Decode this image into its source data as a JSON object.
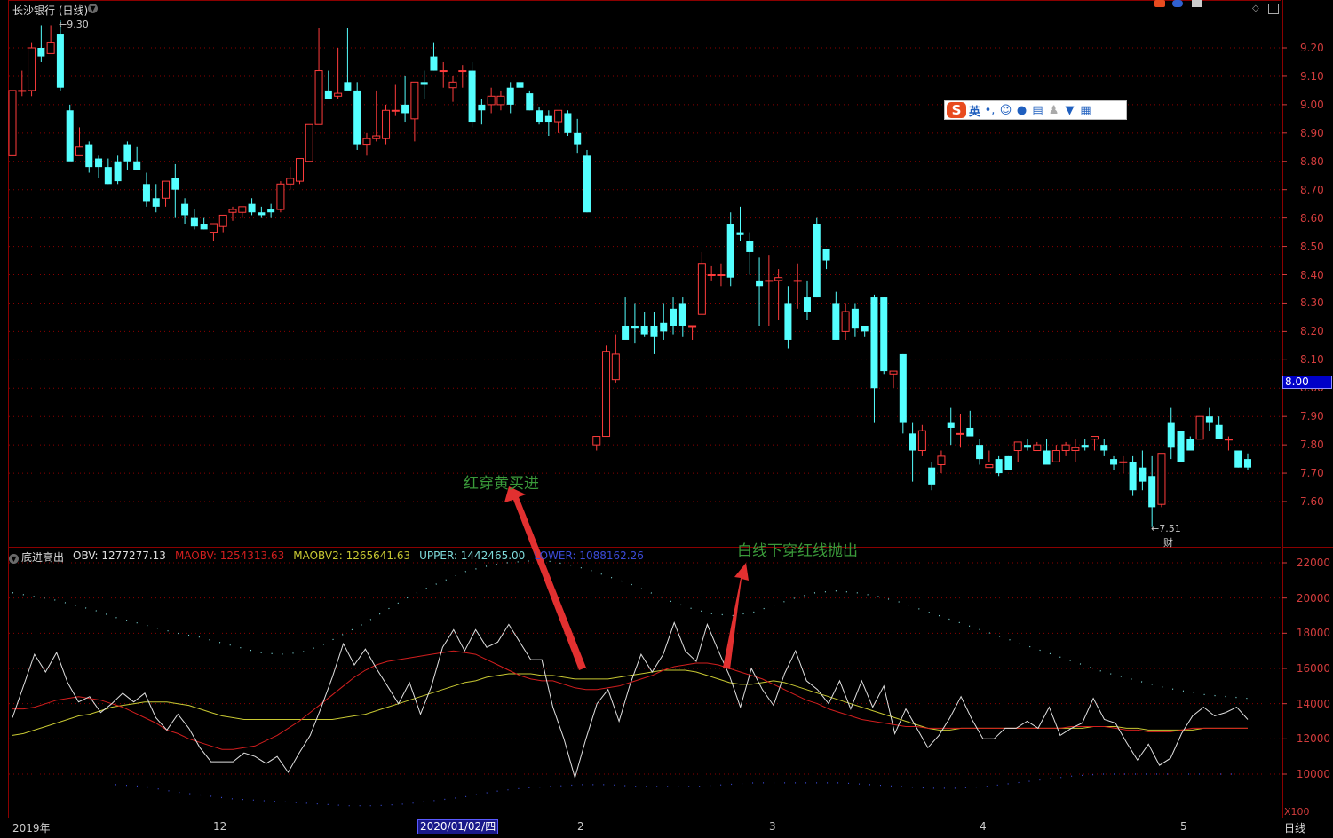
{
  "window": {
    "title": "长沙银行 (日线)",
    "max_label": "9.30",
    "min_label": "7.51",
    "event_marker": "财",
    "period": "日线",
    "x100": "X100"
  },
  "price_badge": "8.00",
  "main_axis_ticks": [
    "9.20",
    "9.10",
    "9.00",
    "8.90",
    "8.80",
    "8.70",
    "8.60",
    "8.50",
    "8.40",
    "8.30",
    "8.20",
    "8.10",
    "8.00",
    "7.90",
    "7.80",
    "7.70",
    "7.60"
  ],
  "indicator_axis_ticks": [
    "22000",
    "20000",
    "18000",
    "16000",
    "14000",
    "12000",
    "10000"
  ],
  "indicator": {
    "name": "底进高出",
    "obv_label": "OBV: 1277277.13",
    "maobv_label": "MAOBV: 1254313.63",
    "maobv2_label": "MAOBV2: 1265641.63",
    "upper_label": "UPPER: 1442465.00",
    "lower_label": "LOWER: 1088162.26",
    "colors": {
      "obv": "#e0e0e0",
      "maobv": "#d21e1e",
      "maobv2": "#c8c832",
      "upper": "#7fdcdc",
      "lower": "#3b4bd8"
    }
  },
  "annotations": {
    "buy": "红穿黄买进",
    "sell": "白线下穿红线抛出"
  },
  "ime": {
    "lang": "英",
    "punct": "•,"
  },
  "date_axis": {
    "year": "2019年",
    "m12": "12",
    "selected_date": "2020/01/02/四",
    "m2": "2",
    "m3": "3",
    "m4": "4",
    "m5": "5"
  },
  "colors": {
    "up": "#ff3c3c",
    "down": "#54ffff",
    "grid": "#8b0000",
    "axis_text": "#d23c3c"
  },
  "chart_data": {
    "type": "candlestick",
    "y_range": [
      7.5,
      9.3
    ],
    "ohlc": [
      [
        8.82,
        9.05,
        8.82,
        9.05
      ],
      [
        9.05,
        9.12,
        9.03,
        9.05
      ],
      [
        9.05,
        9.22,
        9.03,
        9.2
      ],
      [
        9.2,
        9.28,
        9.15,
        9.17
      ],
      [
        9.18,
        9.28,
        9.18,
        9.22
      ],
      [
        9.25,
        9.3,
        9.05,
        9.06
      ],
      [
        8.98,
        9.0,
        8.86,
        8.8
      ],
      [
        8.82,
        8.92,
        8.82,
        8.85
      ],
      [
        8.86,
        8.87,
        8.76,
        8.78
      ],
      [
        8.81,
        8.82,
        8.74,
        8.78
      ],
      [
        8.78,
        8.81,
        8.72,
        8.72
      ],
      [
        8.8,
        8.82,
        8.72,
        8.73
      ],
      [
        8.86,
        8.87,
        8.77,
        8.8
      ],
      [
        8.8,
        8.85,
        8.77,
        8.77
      ],
      [
        8.72,
        8.76,
        8.64,
        8.66
      ],
      [
        8.67,
        8.72,
        8.62,
        8.64
      ],
      [
        8.67,
        8.73,
        8.64,
        8.73
      ],
      [
        8.74,
        8.79,
        8.6,
        8.7
      ],
      [
        8.65,
        8.67,
        8.58,
        8.61
      ],
      [
        8.6,
        8.63,
        8.56,
        8.57
      ],
      [
        8.58,
        8.6,
        8.56,
        8.56
      ],
      [
        8.55,
        8.58,
        8.52,
        8.58
      ],
      [
        8.57,
        8.61,
        8.55,
        8.61
      ],
      [
        8.62,
        8.64,
        8.59,
        8.63
      ],
      [
        8.62,
        8.64,
        8.6,
        8.64
      ],
      [
        8.65,
        8.67,
        8.61,
        8.62
      ],
      [
        8.62,
        8.64,
        8.6,
        8.61
      ],
      [
        8.63,
        8.65,
        8.6,
        8.62
      ],
      [
        8.63,
        8.73,
        8.62,
        8.72
      ],
      [
        8.72,
        8.78,
        8.7,
        8.74
      ],
      [
        8.73,
        8.81,
        8.72,
        8.81
      ],
      [
        8.8,
        8.93,
        8.8,
        8.93
      ],
      [
        8.93,
        9.27,
        8.93,
        9.12
      ],
      [
        9.05,
        9.12,
        9.02,
        9.02
      ],
      [
        9.03,
        9.2,
        9.02,
        9.04
      ],
      [
        9.08,
        9.27,
        9.07,
        9.05
      ],
      [
        9.05,
        9.08,
        8.84,
        8.86
      ],
      [
        8.86,
        8.9,
        8.82,
        8.88
      ],
      [
        8.88,
        9.05,
        8.87,
        8.89
      ],
      [
        8.88,
        9.0,
        8.86,
        8.98
      ],
      [
        8.98,
        9.07,
        8.96,
        8.98
      ],
      [
        9.0,
        9.1,
        8.94,
        8.97
      ],
      [
        8.95,
        9.05,
        8.87,
        9.08
      ],
      [
        9.08,
        9.12,
        9.02,
        9.07
      ],
      [
        9.17,
        9.22,
        9.12,
        9.12
      ],
      [
        9.12,
        9.15,
        9.06,
        9.12
      ],
      [
        9.06,
        9.1,
        9.01,
        9.08
      ],
      [
        9.12,
        9.14,
        9.06,
        9.12
      ],
      [
        9.12,
        9.15,
        8.92,
        8.94
      ],
      [
        9.0,
        9.02,
        8.93,
        8.98
      ],
      [
        9.0,
        9.06,
        8.97,
        9.03
      ],
      [
        9.0,
        9.05,
        8.98,
        9.03
      ],
      [
        9.06,
        9.08,
        8.97,
        9.0
      ],
      [
        9.08,
        9.11,
        9.05,
        9.06
      ],
      [
        9.04,
        9.05,
        8.98,
        8.98
      ],
      [
        8.98,
        8.99,
        8.93,
        8.94
      ],
      [
        8.96,
        8.98,
        8.89,
        8.94
      ],
      [
        8.94,
        8.98,
        8.9,
        8.98
      ],
      [
        8.97,
        8.98,
        8.89,
        8.9
      ],
      [
        8.9,
        8.95,
        8.83,
        8.86
      ],
      [
        8.82,
        8.84,
        8.62,
        8.62
      ],
      [
        7.8,
        7.82,
        7.78,
        7.83
      ],
      [
        7.83,
        8.15,
        7.83,
        8.13
      ],
      [
        8.03,
        8.19,
        8.02,
        8.12
      ],
      [
        8.22,
        8.32,
        8.18,
        8.17
      ],
      [
        8.22,
        8.3,
        8.16,
        8.21
      ],
      [
        8.22,
        8.27,
        8.18,
        8.19
      ],
      [
        8.22,
        8.27,
        8.12,
        8.18
      ],
      [
        8.23,
        8.3,
        8.17,
        8.2
      ],
      [
        8.28,
        8.32,
        8.19,
        8.22
      ],
      [
        8.3,
        8.32,
        8.18,
        8.22
      ],
      [
        8.22,
        8.22,
        8.17,
        8.22
      ],
      [
        8.26,
        8.48,
        8.26,
        8.44
      ],
      [
        8.4,
        8.43,
        8.38,
        8.4
      ],
      [
        8.4,
        8.44,
        8.36,
        8.4
      ],
      [
        8.58,
        8.62,
        8.36,
        8.39
      ],
      [
        8.55,
        8.64,
        8.52,
        8.54
      ],
      [
        8.52,
        8.55,
        8.4,
        8.48
      ],
      [
        8.38,
        8.46,
        8.22,
        8.36
      ],
      [
        8.38,
        8.47,
        8.22,
        8.38
      ],
      [
        8.38,
        8.42,
        8.24,
        8.39
      ],
      [
        8.3,
        8.36,
        8.14,
        8.17
      ],
      [
        8.38,
        8.44,
        8.28,
        8.38
      ],
      [
        8.32,
        8.38,
        8.24,
        8.27
      ],
      [
        8.58,
        8.6,
        8.32,
        8.32
      ],
      [
        8.49,
        8.48,
        8.42,
        8.45
      ],
      [
        8.3,
        8.34,
        8.17,
        8.17
      ],
      [
        8.2,
        8.3,
        8.17,
        8.27
      ],
      [
        8.28,
        8.3,
        8.18,
        8.21
      ],
      [
        8.22,
        8.22,
        8.18,
        8.2
      ],
      [
        8.32,
        8.33,
        7.88,
        8.0
      ],
      [
        8.32,
        8.32,
        8.05,
        8.06
      ],
      [
        8.05,
        8.05,
        8.0,
        8.06
      ],
      [
        8.12,
        8.12,
        7.84,
        7.88
      ],
      [
        7.84,
        7.88,
        7.67,
        7.78
      ],
      [
        7.78,
        7.87,
        7.76,
        7.85
      ],
      [
        7.72,
        7.74,
        7.64,
        7.66
      ],
      [
        7.73,
        7.78,
        7.7,
        7.76
      ],
      [
        7.88,
        7.93,
        7.8,
        7.86
      ],
      [
        7.84,
        7.91,
        7.79,
        7.84
      ],
      [
        7.86,
        7.92,
        7.84,
        7.83
      ],
      [
        7.8,
        7.82,
        7.73,
        7.75
      ],
      [
        7.72,
        7.78,
        7.74,
        7.73
      ],
      [
        7.75,
        7.76,
        7.69,
        7.7
      ],
      [
        7.76,
        7.76,
        7.71,
        7.71
      ],
      [
        7.78,
        7.8,
        7.74,
        7.81
      ],
      [
        7.8,
        7.82,
        7.78,
        7.79
      ],
      [
        7.78,
        7.81,
        7.78,
        7.8
      ],
      [
        7.78,
        7.82,
        7.75,
        7.73
      ],
      [
        7.74,
        7.8,
        7.74,
        7.78
      ],
      [
        7.78,
        7.81,
        7.76,
        7.8
      ],
      [
        7.78,
        7.82,
        7.74,
        7.79
      ],
      [
        7.8,
        7.82,
        7.78,
        7.79
      ],
      [
        7.82,
        7.82,
        7.78,
        7.83
      ],
      [
        7.8,
        7.82,
        7.76,
        7.78
      ],
      [
        7.75,
        7.76,
        7.71,
        7.73
      ],
      [
        7.74,
        7.76,
        7.7,
        7.74
      ],
      [
        7.74,
        7.76,
        7.62,
        7.64
      ],
      [
        7.72,
        7.78,
        7.64,
        7.67
      ],
      [
        7.69,
        7.76,
        7.51,
        7.58
      ],
      [
        7.59,
        7.77,
        7.58,
        7.77
      ],
      [
        7.88,
        7.93,
        7.75,
        7.79
      ],
      [
        7.85,
        7.85,
        7.76,
        7.74
      ],
      [
        7.82,
        7.83,
        7.78,
        7.78
      ],
      [
        7.82,
        7.9,
        7.82,
        7.9
      ],
      [
        7.9,
        7.93,
        7.85,
        7.88
      ],
      [
        7.87,
        7.9,
        7.83,
        7.82
      ],
      [
        7.82,
        7.83,
        7.78,
        7.82
      ],
      [
        7.78,
        7.78,
        7.72,
        7.72
      ],
      [
        7.75,
        7.77,
        7.71,
        7.72
      ]
    ],
    "obv": [
      13.2,
      15.0,
      16.8,
      15.8,
      16.9,
      15.2,
      14.1,
      14.4,
      13.5,
      14.0,
      14.6,
      14.1,
      14.6,
      13.2,
      12.5,
      13.4,
      12.6,
      11.5,
      10.7,
      10.7,
      10.7,
      11.2,
      11.0,
      10.6,
      11.0,
      10.1,
      11.2,
      12.2,
      13.8,
      15.5,
      17.4,
      16.2,
      17.1,
      16.0,
      15.0,
      14.0,
      15.2,
      13.4,
      15.0,
      17.2,
      18.2,
      17.0,
      18.2,
      17.2,
      17.5,
      18.5,
      17.5,
      16.5,
      16.5,
      13.8,
      12.0,
      9.8,
      12.0,
      14.0,
      14.8,
      13.0,
      15.1,
      16.8,
      15.8,
      16.8,
      18.6,
      17.0,
      16.4,
      18.5,
      17.0,
      15.6,
      13.8,
      16.0,
      14.8,
      13.9,
      15.7,
      17.0,
      15.3,
      14.8,
      14.0,
      15.3,
      13.7,
      15.3,
      13.8,
      15.0,
      12.3,
      13.7,
      12.6,
      11.5,
      12.2,
      13.2,
      14.4,
      13.1,
      12.0,
      12.0,
      12.6,
      12.6,
      13.0,
      12.6,
      13.8,
      12.2,
      12.6,
      12.9,
      14.3,
      13.1,
      12.9,
      11.8,
      10.8,
      11.7,
      10.5,
      10.9,
      12.3,
      13.3,
      13.8,
      13.3,
      13.5,
      13.8,
      13.1
    ],
    "maobv": [
      13.7,
      13.7,
      13.8,
      14.0,
      14.2,
      14.3,
      14.4,
      14.3,
      14.2,
      14.0,
      13.8,
      13.5,
      13.2,
      12.9,
      12.5,
      12.3,
      12.0,
      11.8,
      11.6,
      11.4,
      11.4,
      11.5,
      11.6,
      11.9,
      12.2,
      12.6,
      13.0,
      13.5,
      14.0,
      14.5,
      15.0,
      15.5,
      15.9,
      16.2,
      16.4,
      16.5,
      16.6,
      16.7,
      16.8,
      16.9,
      17.0,
      16.9,
      16.8,
      16.5,
      16.2,
      15.9,
      15.6,
      15.4,
      15.3,
      15.3,
      15.1,
      14.9,
      14.8,
      14.8,
      14.9,
      15.0,
      15.2,
      15.4,
      15.6,
      15.9,
      16.1,
      16.2,
      16.3,
      16.3,
      16.2,
      16.0,
      15.8,
      15.6,
      15.4,
      15.1,
      14.8,
      14.5,
      14.2,
      14.0,
      13.7,
      13.5,
      13.3,
      13.1,
      13.0,
      12.9,
      12.8,
      12.7,
      12.7,
      12.6,
      12.6,
      12.6,
      12.6,
      12.6,
      12.6,
      12.6,
      12.6,
      12.6,
      12.6,
      12.6,
      12.6,
      12.6,
      12.7,
      12.7,
      12.7,
      12.7,
      12.6,
      12.5,
      12.5,
      12.4,
      12.4,
      12.4,
      12.5,
      12.6,
      12.6,
      12.6,
      12.6,
      12.6,
      12.6
    ],
    "maobv2": [
      12.2,
      12.3,
      12.5,
      12.7,
      12.9,
      13.1,
      13.3,
      13.4,
      13.6,
      13.8,
      13.9,
      14.0,
      14.1,
      14.1,
      14.1,
      14.0,
      13.9,
      13.7,
      13.5,
      13.3,
      13.2,
      13.1,
      13.1,
      13.1,
      13.1,
      13.1,
      13.1,
      13.1,
      13.1,
      13.1,
      13.2,
      13.3,
      13.4,
      13.6,
      13.8,
      14.0,
      14.2,
      14.4,
      14.6,
      14.8,
      15.0,
      15.2,
      15.3,
      15.5,
      15.6,
      15.7,
      15.7,
      15.7,
      15.6,
      15.6,
      15.5,
      15.4,
      15.4,
      15.4,
      15.4,
      15.5,
      15.6,
      15.7,
      15.8,
      15.9,
      15.9,
      15.9,
      15.8,
      15.6,
      15.4,
      15.2,
      15.1,
      15.1,
      15.2,
      15.3,
      15.2,
      15.0,
      14.8,
      14.6,
      14.4,
      14.2,
      14.0,
      13.8,
      13.6,
      13.4,
      13.2,
      13.0,
      12.8,
      12.6,
      12.5,
      12.5,
      12.6,
      12.6,
      12.6,
      12.6,
      12.6,
      12.6,
      12.6,
      12.6,
      12.6,
      12.6,
      12.6,
      12.6,
      12.7,
      12.7,
      12.7,
      12.6,
      12.6,
      12.5,
      12.5,
      12.5,
      12.5,
      12.5,
      12.6,
      12.6,
      12.6,
      12.6,
      12.6
    ],
    "upper": [
      20.3,
      20.1,
      19.9,
      19.6,
      19.3,
      18.9,
      18.6,
      18.3,
      18.0,
      17.8,
      17.5,
      17.2,
      16.9,
      16.8,
      16.9,
      17.3,
      17.9,
      18.5,
      19.2,
      19.9,
      20.5,
      21.0,
      21.5,
      21.8,
      22.0,
      22.1,
      22.1,
      21.9,
      21.6,
      21.2,
      20.8,
      20.3,
      19.8,
      19.4,
      19.1,
      19.0,
      19.2,
      19.6,
      20.0,
      20.3,
      20.4,
      20.3,
      20.1,
      19.8,
      19.4,
      19.0,
      18.6,
      18.2,
      17.8,
      17.4,
      17.0,
      16.6,
      16.2,
      15.8,
      15.5,
      15.2,
      14.9,
      14.7,
      14.5,
      14.4,
      14.3
    ],
    "lower": [
      9.4,
      9.3,
      9.0,
      8.8,
      8.6,
      8.5,
      8.4,
      8.3,
      8.2,
      8.2,
      8.3,
      8.5,
      8.7,
      9.0,
      9.2,
      9.3,
      9.4,
      9.4,
      9.3,
      9.3,
      9.3,
      9.4,
      9.5,
      9.5,
      9.5,
      9.5,
      9.4,
      9.3,
      9.2,
      9.2,
      9.3,
      9.5,
      9.7,
      9.9,
      10.0,
      10.0,
      10.0,
      10.0,
      10.0,
      10.0
    ]
  }
}
